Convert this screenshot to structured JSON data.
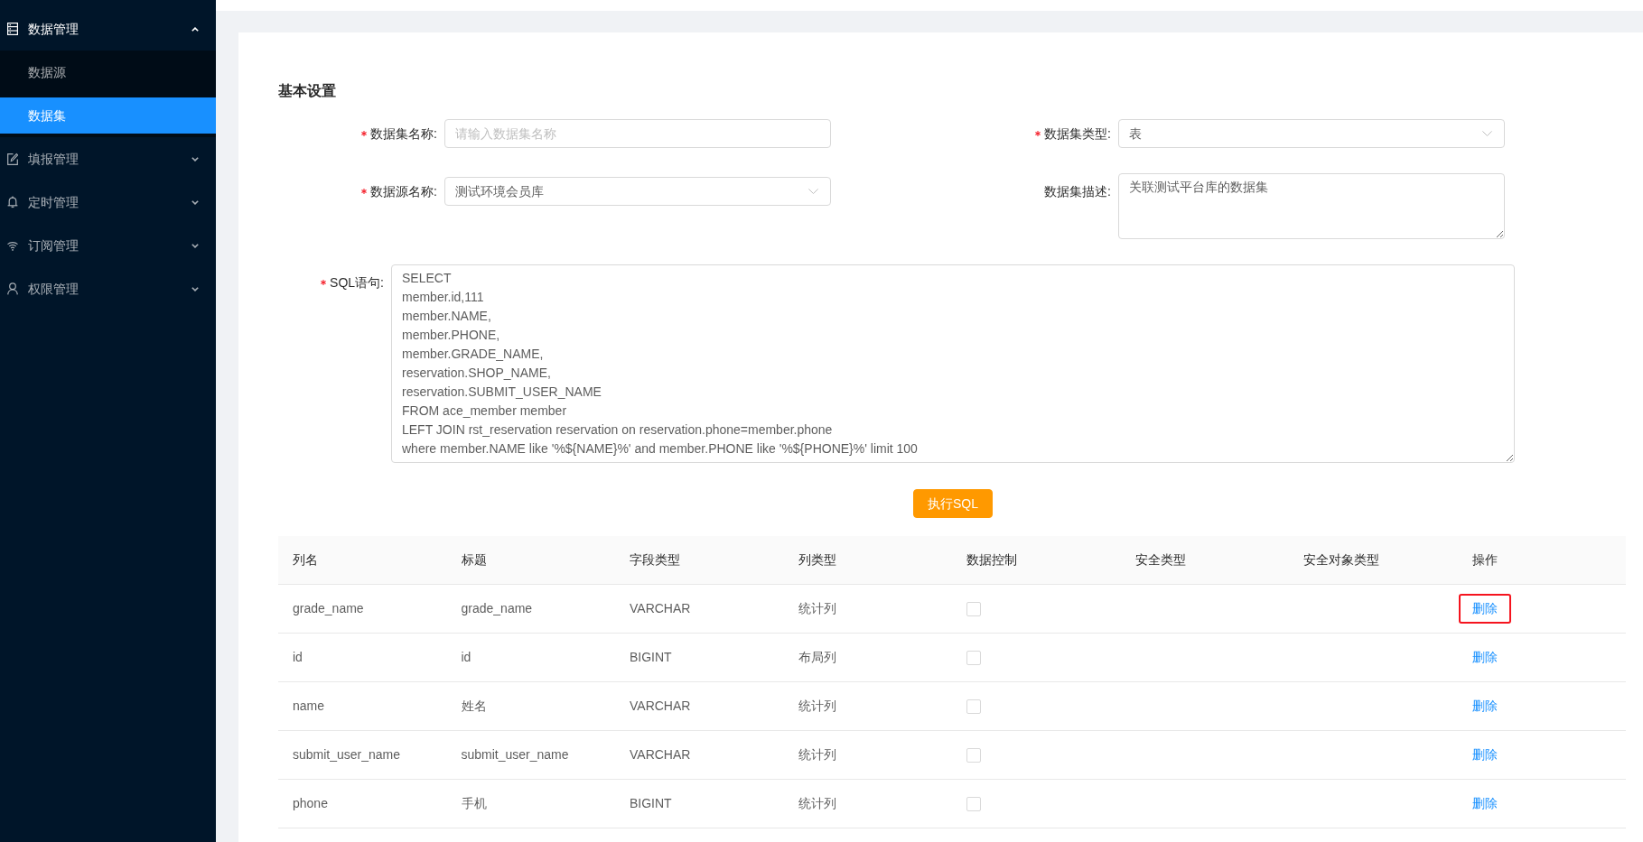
{
  "sidebar": {
    "items": [
      {
        "label": "数据管理",
        "expanded": true,
        "children": [
          {
            "label": "数据源",
            "selected": false
          },
          {
            "label": "数据集",
            "selected": true
          }
        ]
      },
      {
        "label": "填报管理",
        "expanded": false
      },
      {
        "label": "定时管理",
        "expanded": false
      },
      {
        "label": "订阅管理",
        "expanded": false
      },
      {
        "label": "权限管理",
        "expanded": false
      }
    ]
  },
  "form": {
    "title": "基本设置",
    "fields": [
      {
        "label": "数据集名称:",
        "required": true,
        "kind": "input",
        "placeholder": "请输入数据集名称"
      },
      {
        "label": "数据集类型:",
        "required": true,
        "kind": "select",
        "value": "表"
      },
      {
        "label": "数据源名称:",
        "required": true,
        "kind": "select",
        "value": "测试环境会员库"
      },
      {
        "label": "数据集描述:",
        "required": false,
        "kind": "textarea",
        "value": "关联测试平台库的数据集"
      },
      {
        "label": "SQL语句:",
        "required": true,
        "kind": "sql_editor",
        "value": "SELECT\nmember.id,111\nmember.NAME,\nmember.PHONE,\nmember.GRADE_NAME,\nreservation.SHOP_NAME,\nreservation.SUBMIT_USER_NAME\nFROM ace_member member\nLEFT JOIN rst_reservation reservation on reservation.phone=member.phone\nwhere member.NAME like '%${NAME}%' and member.PHONE like '%${PHONE}%' limit 100"
      }
    ],
    "submit_button": "执行SQL"
  },
  "table": {
    "columns": [
      "列名",
      "标题",
      "字段类型",
      "列类型",
      "数据控制",
      "安全类型",
      "安全对象类型",
      "操作"
    ],
    "rows": [
      {
        "name": "grade_name",
        "title": "grade_name",
        "field_type": "VARCHAR",
        "column_type": "统计列",
        "checked": false,
        "action": "删除",
        "highlighted": true
      },
      {
        "name": "id",
        "title": "id",
        "field_type": "BIGINT",
        "column_type": "布局列",
        "checked": false,
        "action": "删除",
        "highlighted": false
      },
      {
        "name": "name",
        "title": "姓名",
        "field_type": "VARCHAR",
        "column_type": "统计列",
        "checked": false,
        "action": "删除",
        "highlighted": false
      },
      {
        "name": "submit_user_name",
        "title": "submit_user_name",
        "field_type": "VARCHAR",
        "column_type": "统计列",
        "checked": false,
        "action": "删除",
        "highlighted": false
      },
      {
        "name": "phone",
        "title": "手机",
        "field_type": "BIGINT",
        "column_type": "统计列",
        "checked": false,
        "action": "删除",
        "highlighted": false
      }
    ]
  }
}
